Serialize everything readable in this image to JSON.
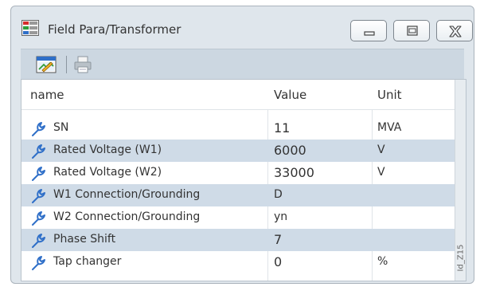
{
  "window": {
    "title": "Field Para/Transformer"
  },
  "toolbar": {
    "icons": [
      "edit-parameters-icon",
      "print-icon"
    ]
  },
  "table": {
    "columns": [
      "name",
      "Value",
      "Unit"
    ],
    "rows": [
      {
        "name": "SN",
        "value": "11",
        "unit": "MVA"
      },
      {
        "name": "Rated Voltage (W1)",
        "value": "6000",
        "unit": "V"
      },
      {
        "name": "Rated Voltage (W2)",
        "value": "33000",
        "unit": "V"
      },
      {
        "name": "W1 Connection/Grounding",
        "value": "D",
        "unit": ""
      },
      {
        "name": "W2 Connection/Grounding",
        "value": "yn",
        "unit": ""
      },
      {
        "name": "Phase Shift",
        "value": "7",
        "unit": ""
      },
      {
        "name": "Tap changer",
        "value": "0",
        "unit": "%"
      }
    ]
  },
  "side_label": "Id_Z15",
  "colors": {
    "window_bg": "#dfe6ec",
    "toolbar_bg": "#ccd7e1",
    "row_alt": "#cfdbe7",
    "icon_blue": "#2f6fc8"
  }
}
